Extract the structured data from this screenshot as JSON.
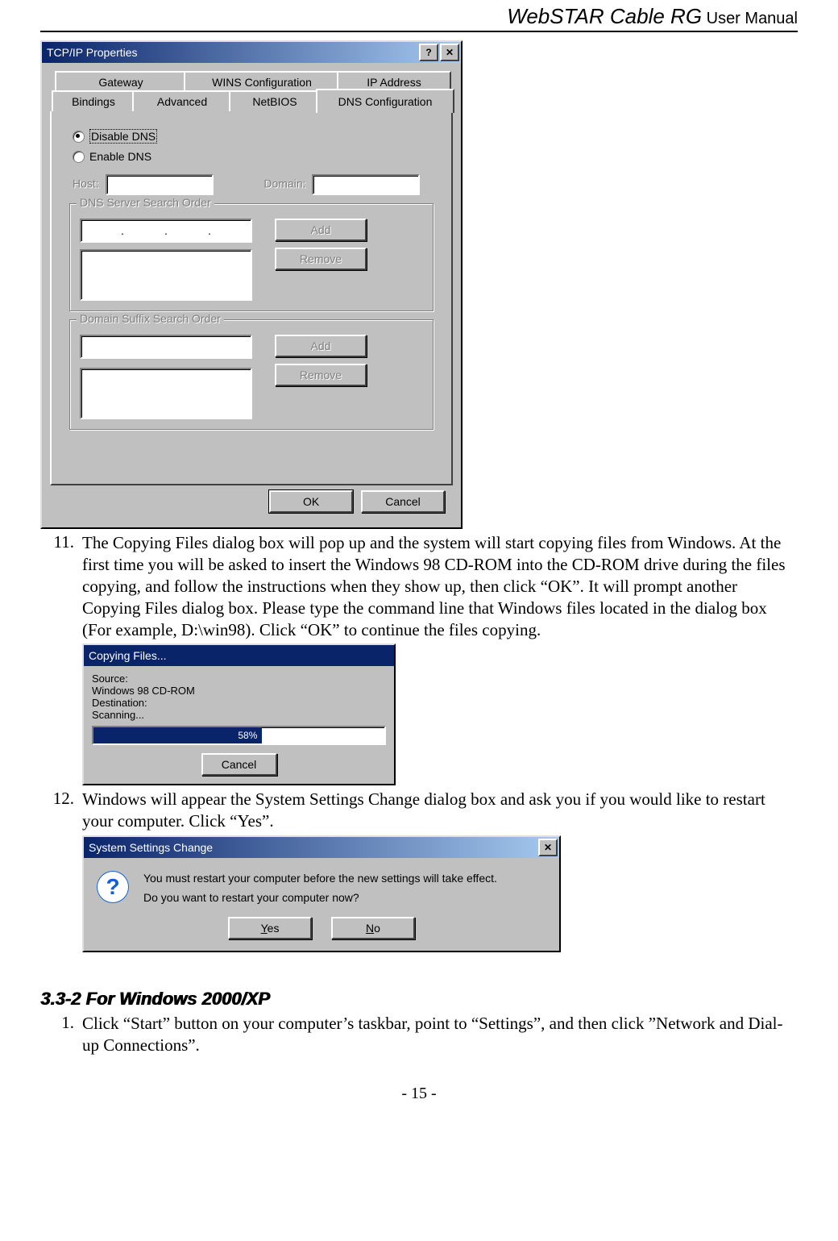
{
  "header": {
    "brand": "WebSTAR Cable RG",
    "suffix": " User Manual"
  },
  "tcpip": {
    "title": "TCP/IP Properties",
    "tabs_back": [
      "Gateway",
      "WINS Configuration",
      "IP Address"
    ],
    "tabs_front": [
      "Bindings",
      "Advanced",
      "NetBIOS",
      "DNS Configuration"
    ],
    "active_tab_index": 3,
    "radio_disable": "Disable DNS",
    "radio_enable": "Enable DNS",
    "lbl_host": "Host:",
    "lbl_domain": "Domain:",
    "grp_dns": "DNS Server Search Order",
    "grp_suffix": "Domain Suffix Search Order",
    "btn_add": "Add",
    "btn_remove": "Remove",
    "btn_ok": "OK",
    "btn_cancel": "Cancel",
    "help_glyph": "?",
    "close_glyph": "✕"
  },
  "step11": {
    "num": "11.",
    "text": "The Copying Files dialog box will pop up and the system will start copying files from Windows. At the first time you will be asked to insert the Windows 98 CD-ROM into the CD-ROM drive during the files copying, and follow the instructions when they show up, then click “OK”. It will prompt another Copying Files dialog box. Please type the command line that Windows files located in the dialog box (For example, D:\\win98). Click “OK” to continue the files copying."
  },
  "copying": {
    "title": "Copying Files...",
    "source_lbl": "Source:",
    "source_val": "Windows 98 CD-ROM",
    "dest_lbl": "Destination:",
    "scan_lbl": "Scanning...",
    "percent_text": "58%",
    "percent_value": 58,
    "btn_cancel": "Cancel"
  },
  "step12": {
    "num": "12.",
    "text": "Windows will appear the System Settings Change dialog box and ask you if you would like to restart your computer. Click “Yes”."
  },
  "ssc": {
    "title": "System Settings Change",
    "close_glyph": "✕",
    "line1": "You must restart your computer before the new settings will take effect.",
    "line2": "Do you want to restart your computer now?",
    "yes_pre": "",
    "yes_u": "Y",
    "yes_post": "es",
    "no_u": "N",
    "no_post": "o"
  },
  "section_title": "3.3-2 For Windows 2000/XP",
  "step1": {
    "num": "1.",
    "text": "Click “Start” button on your computer’s taskbar, point to “Settings”, and then click ”Network and Dial-up Connections”."
  },
  "footer": "- 15 -"
}
